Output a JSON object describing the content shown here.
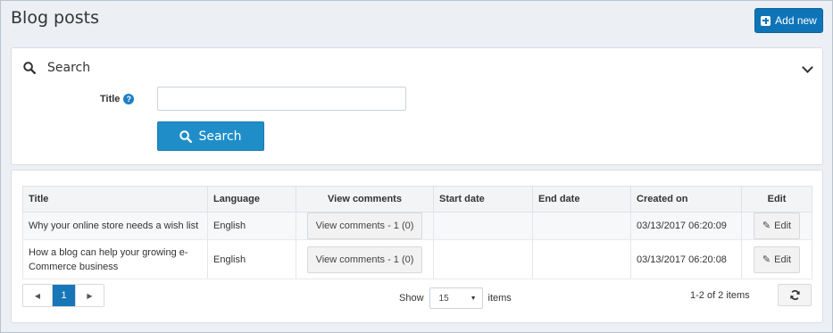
{
  "header": {
    "title": "Blog posts",
    "add_label": "Add new"
  },
  "search": {
    "heading": "Search",
    "title_label": "Title",
    "help_glyph": "?",
    "title_value": "",
    "button_label": "Search"
  },
  "table": {
    "columns": [
      "Title",
      "Language",
      "View comments",
      "Start date",
      "End date",
      "Created on",
      "Edit"
    ],
    "rows": [
      {
        "title": "Why your online store needs a wish list",
        "language": "English",
        "view_comments": "View comments - 1 (0)",
        "start_date": "",
        "end_date": "",
        "created_on": "03/13/2017 06:20:09",
        "edit": "Edit"
      },
      {
        "title": "How a blog can help your growing e-Commerce business",
        "language": "English",
        "view_comments": "View comments - 1 (0)",
        "start_date": "",
        "end_date": "",
        "created_on": "03/13/2017 06:20:08",
        "edit": "Edit"
      }
    ]
  },
  "pager": {
    "prev_glyph": "◀",
    "current_page": "1",
    "next_glyph": "▶",
    "show_label": "Show",
    "page_size": "15",
    "items_label": "items",
    "range_text": "1-2 of 2 items"
  },
  "colors": {
    "primary": "#0f74b7",
    "search_button": "#1f8ec8",
    "active_page": "#1676b8",
    "background": "#ecf0f5"
  },
  "icons": {
    "add": "plus-square-icon",
    "search": "search-icon",
    "collapse": "chevron-down-icon",
    "help": "question-circle-icon",
    "edit": "pencil-icon",
    "refresh": "refresh-icon"
  }
}
